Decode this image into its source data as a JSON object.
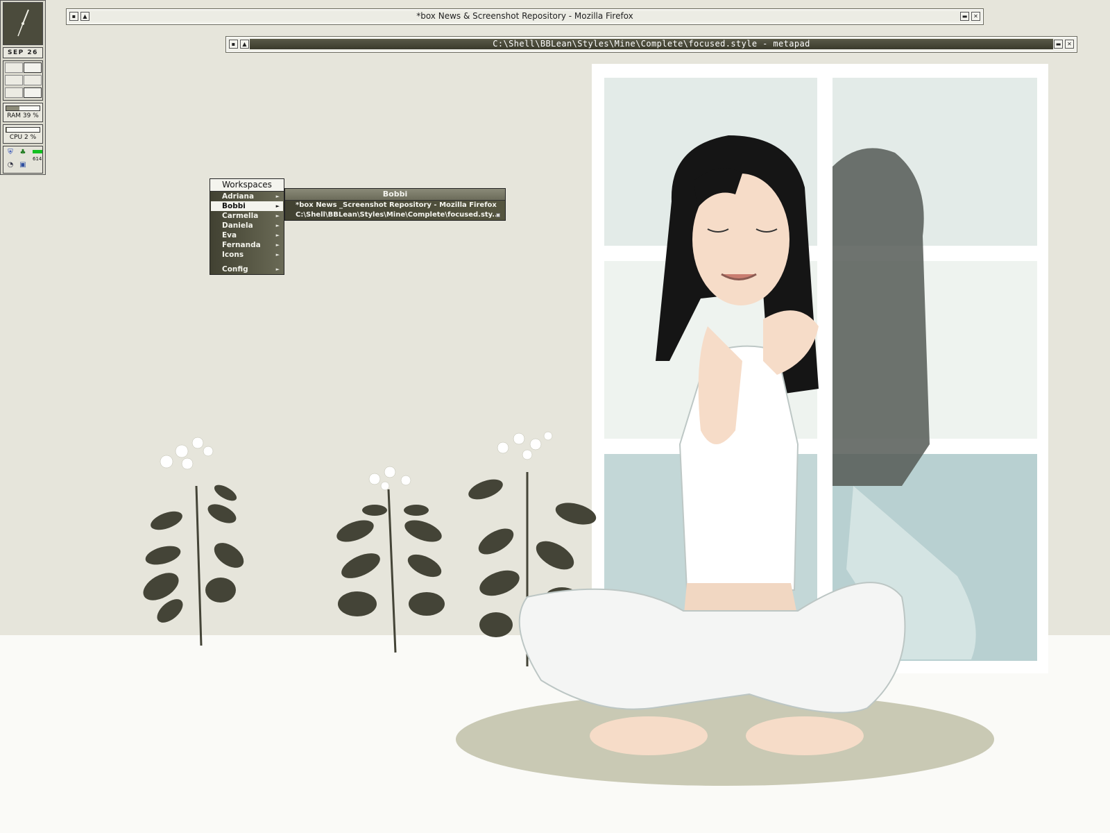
{
  "windows": {
    "firefox": {
      "title": "*box News & Screenshot Repository - Mozilla Firefox"
    },
    "metapad": {
      "title": "C:\\Shell\\BBLean\\Styles\\Mine\\Complete\\focused.style - metapad"
    }
  },
  "slit": {
    "date": "SEP 26",
    "ram": {
      "label": "RAM 39 %",
      "value": 0.39
    },
    "cpu": {
      "label": "CPU 2 %",
      "value": 0.02
    },
    "tray_count": "614",
    "tray_icons": [
      "shield-icon",
      "network-icon",
      "clock-app-icon",
      "monitor-icon"
    ]
  },
  "workspaces_menu": {
    "title": "Workspaces",
    "items": [
      {
        "label": "Adriana",
        "selected": false
      },
      {
        "label": "Bobbi",
        "selected": true
      },
      {
        "label": "Carmella",
        "selected": false
      },
      {
        "label": "Daniela",
        "selected": false
      },
      {
        "label": "Eva",
        "selected": false
      },
      {
        "label": "Fernanda",
        "selected": false
      },
      {
        "label": "Icons",
        "selected": false
      },
      {
        "label": "Config",
        "selected": false
      }
    ]
  },
  "bobbi_menu": {
    "title": "Bobbi",
    "items": [
      {
        "label": "*box News _Screenshot Repository - Mozilla Firefox"
      },
      {
        "label": "C:\\Shell\\BBLean\\Styles\\Mine\\Complete\\focused.sty..."
      }
    ]
  },
  "colors": {
    "wall": "#e6e5db",
    "floor": "#fafaf7",
    "menu_dark": "#4a4a3a",
    "accent_light": "#f4f4ee"
  }
}
